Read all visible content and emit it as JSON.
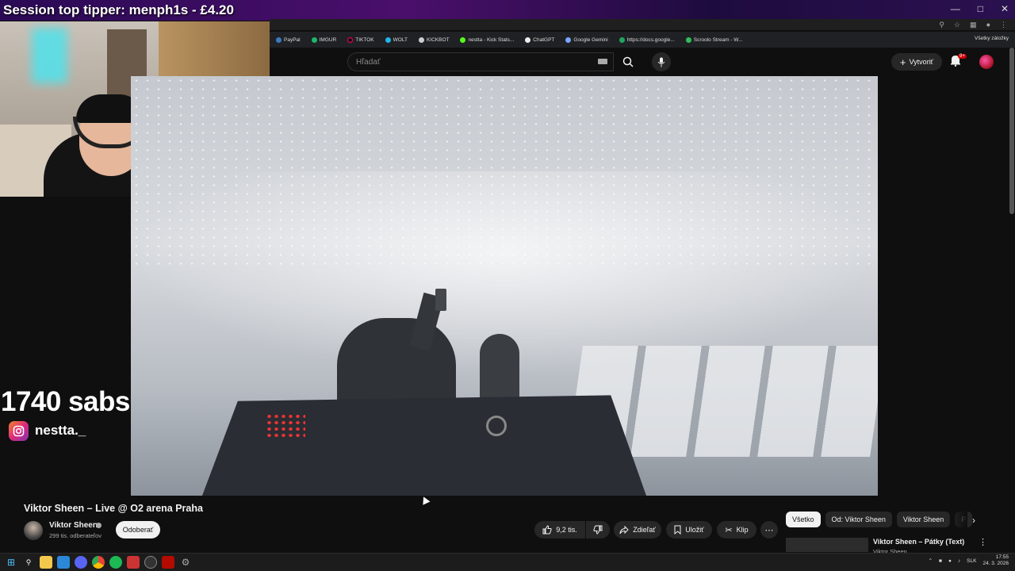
{
  "stream_overlay": {
    "tipper": "Session top tipper: menph1s - £4.20",
    "sabs": "1740 sabs",
    "instagram_handle": "nestta._"
  },
  "browser": {
    "bookmarks": [
      "PayPal",
      "IMGUR",
      "TIKTOK",
      "WOLT",
      "KICKBOT",
      "nestta - Kick Stats...",
      "ChatGPT",
      "Google Gemini",
      "https://docs.google...",
      "Scroolo Stream - W..."
    ],
    "all_bookmarks": "Všetky záložky"
  },
  "youtube": {
    "search_placeholder": "Hľadať",
    "create_label": "Vytvoriť",
    "notifications_badge": "9+",
    "video_title": "Viktor Sheen – Live @ O2 arena Praha",
    "channel_name": "Viktor Sheen",
    "subscribers": "299 tis. odberateľov",
    "subscribe_label": "Odoberať",
    "like_count": "9,2 tis.",
    "share_label": "Zdieľať",
    "save_label": "Uložiť",
    "clip_label": "Klip",
    "chips": [
      "Všetko",
      "Od: Viktor Sheen",
      "Viktor Sheen",
      "P"
    ],
    "recommendation": {
      "title": "Viktor Sheen – Pátky (Text)",
      "channel": "Viktor Sheen"
    }
  },
  "taskbar": {
    "language": "SLK",
    "time": "17:55",
    "date": "24. 3. 2026"
  }
}
